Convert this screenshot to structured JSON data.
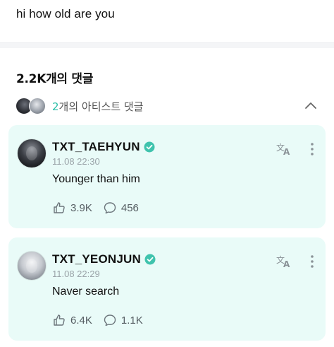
{
  "post": {
    "text": "hi how old are you"
  },
  "comments_header": {
    "title": "2.2K개의 댓글"
  },
  "artist_comments": {
    "count": "2",
    "label": "개의 아티스트 댓글"
  },
  "comments": [
    {
      "username": "TXT_TAEHYUN",
      "timestamp": "11.08 22:30",
      "text": "Younger than him",
      "likes": "3.9K",
      "replies": "456"
    },
    {
      "username": "TXT_YEONJUN",
      "timestamp": "11.08 22:29",
      "text": "Naver search",
      "likes": "6.4K",
      "replies": "1.1K"
    }
  ],
  "colors": {
    "card_bg": "#e9fbf8",
    "accent": "#2dbfa8",
    "verified": "#3fc3ad"
  },
  "icons": [
    "chevron-up-icon",
    "verified-icon",
    "translate-icon",
    "more-icon",
    "like-icon",
    "reply-icon"
  ]
}
